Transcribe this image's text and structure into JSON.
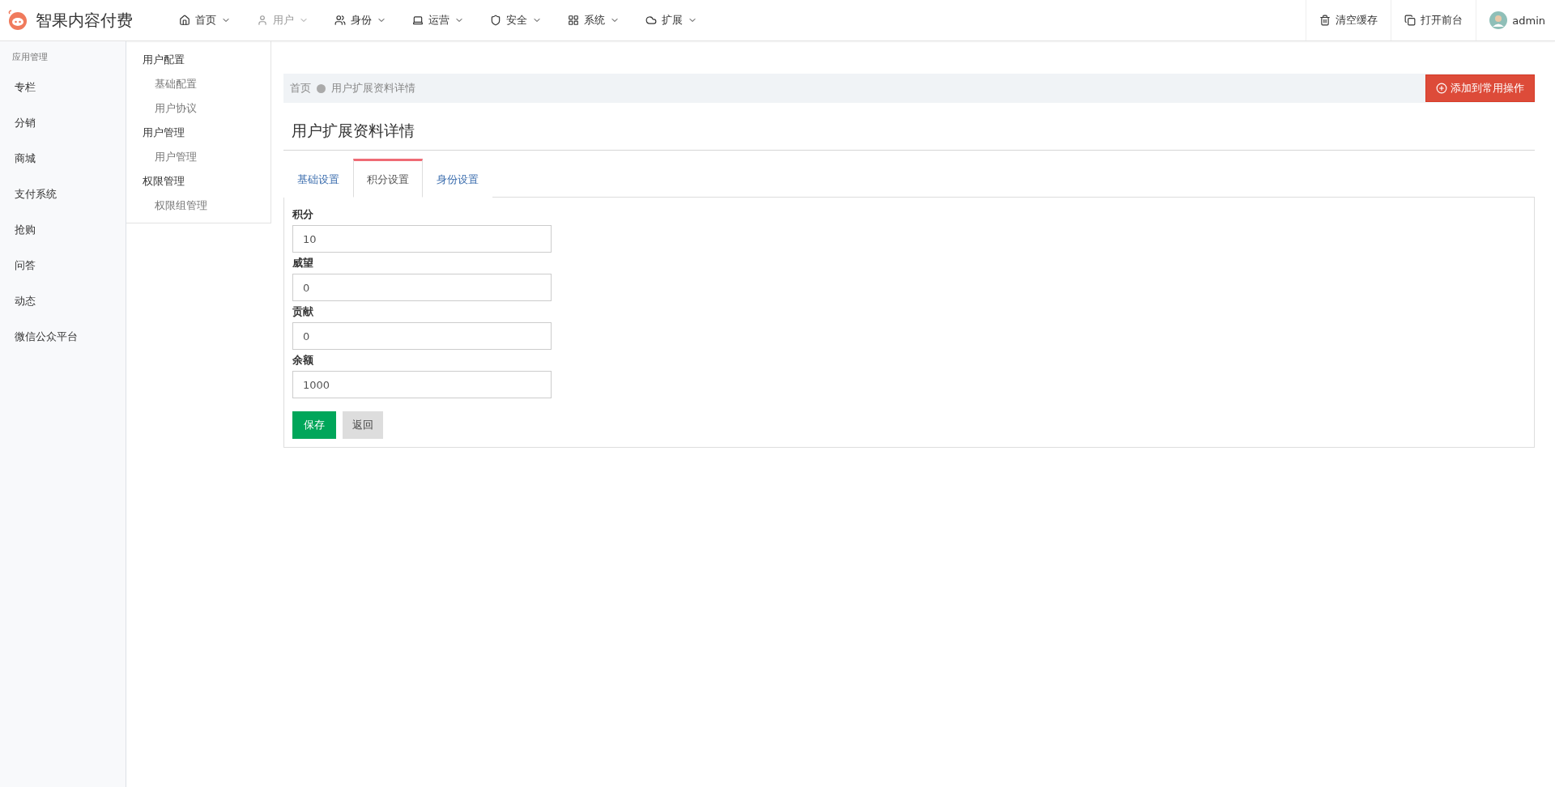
{
  "brand": {
    "name": "智果内容付费"
  },
  "nav": [
    {
      "label": "首页",
      "selected": false
    },
    {
      "label": "用户",
      "selected": true
    },
    {
      "label": "身份",
      "selected": false
    },
    {
      "label": "运营",
      "selected": false
    },
    {
      "label": "安全",
      "selected": false
    },
    {
      "label": "系统",
      "selected": false
    },
    {
      "label": "扩展",
      "selected": false
    }
  ],
  "top_actions": [
    {
      "label": "清空缓存"
    },
    {
      "label": "打开前台"
    }
  ],
  "user": {
    "name": "admin"
  },
  "sidebar": {
    "heading": "应用管理",
    "items": [
      "专栏",
      "分销",
      "商城",
      "支付系统",
      "抢购",
      "问答",
      "动态",
      "微信公众平台"
    ]
  },
  "submenu": [
    {
      "label": "用户配置",
      "children": [
        {
          "label": "基础配置"
        },
        {
          "label": "用户协议"
        }
      ]
    },
    {
      "label": "用户管理",
      "children": [
        {
          "label": "用户管理"
        }
      ]
    },
    {
      "label": "权限管理",
      "children": [
        {
          "label": "权限组管理"
        }
      ]
    }
  ],
  "breadcrumb": [
    "首页",
    "用户扩展资料详情"
  ],
  "add_button": "添加到常用操作",
  "page_title": "用户扩展资料详情",
  "tabs": [
    {
      "label": "基础设置",
      "selected": false
    },
    {
      "label": "积分设置",
      "selected": true
    },
    {
      "label": "身份设置",
      "selected": false
    }
  ],
  "fields": [
    {
      "label": "积分",
      "value": "10"
    },
    {
      "label": "威望",
      "value": "0"
    },
    {
      "label": "贡献",
      "value": "0"
    },
    {
      "label": "余额",
      "value": "1000"
    }
  ],
  "buttons": {
    "save": "保存",
    "back": "返回"
  }
}
